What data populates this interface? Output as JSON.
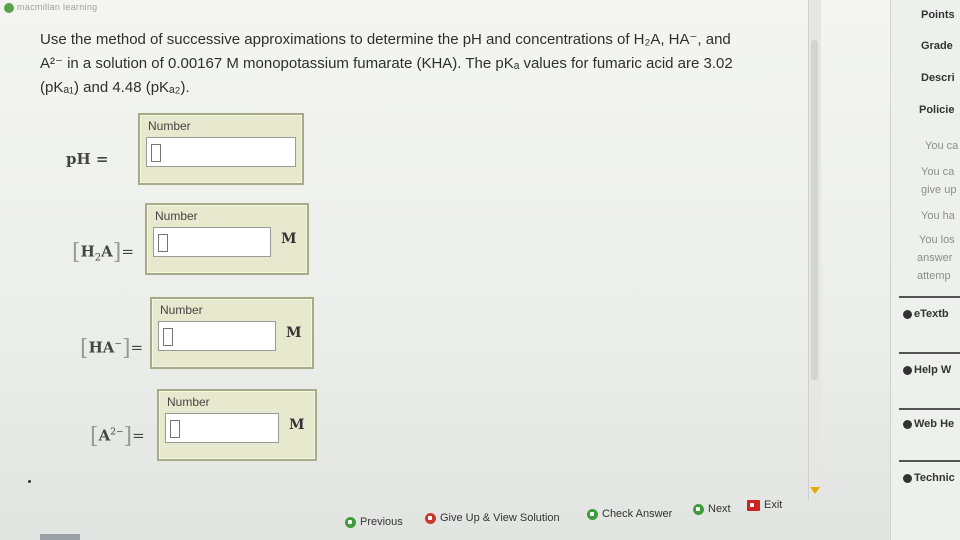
{
  "brand": {
    "name": "macmillan learning"
  },
  "question": {
    "line1": "Use the method of successive approximations to determine the pH and concentrations of H₂A, HA⁻, and",
    "line2": "A²⁻ in a solution of 0.00167 M monopotassium fumarate (KHA). The pKₐ values for fumaric acid are 3.02",
    "line3": "(pKₐ₁) and 4.48 (pKₐ₂)."
  },
  "answers": [
    {
      "label": "pH =",
      "number_label": "Number",
      "value": "",
      "unit": ""
    },
    {
      "label_main": "H",
      "label_sub": "2",
      "label_tail": "A",
      "number_label": "Number",
      "value": "",
      "unit": "M"
    },
    {
      "label_main": "HA",
      "label_sup": "−",
      "number_label": "Number",
      "value": "",
      "unit": "M"
    },
    {
      "label_main": "A",
      "label_sup": "2−",
      "number_label": "Number",
      "value": "",
      "unit": "M"
    }
  ],
  "equals": "=",
  "bottom_bar": {
    "previous": "Previous",
    "give_up": "Give Up & View Solution",
    "check": "Check Answer",
    "next": "Next",
    "exit": "Exit"
  },
  "right_panel": {
    "points": "Points",
    "grade": "Grade",
    "description": "Descri",
    "policies": "Policie",
    "notes": [
      "You ca",
      "You ca",
      "give up",
      "You ha",
      "You los",
      "answer",
      "attemp"
    ],
    "links": [
      "eTextb",
      "Help W",
      "Web He",
      "Technic"
    ]
  },
  "colors": {
    "panel_bg": "#e7e9cf",
    "panel_border": "#a8ac86",
    "green": "#3e9c3a",
    "red": "#c63b2d"
  }
}
